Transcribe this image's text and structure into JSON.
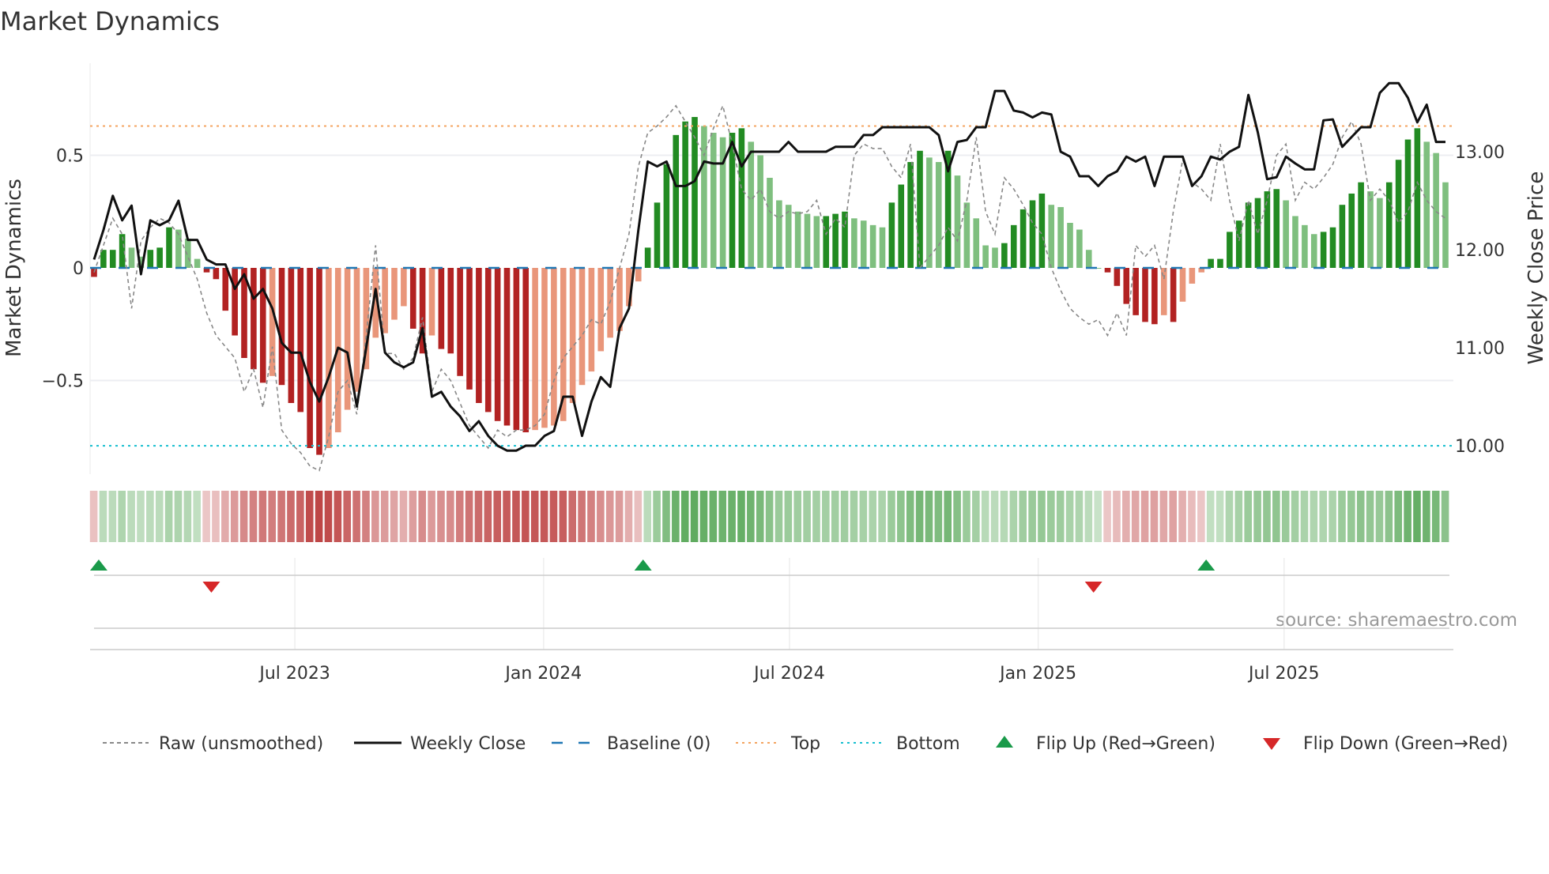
{
  "chart_data": {
    "type": "bar",
    "title": "Market Dynamics",
    "ylabel": "Market Dynamics",
    "y2label": "Weekly Close Price",
    "ylim": [
      -0.9,
      0.93
    ],
    "y2lim": [
      9.75,
      13.85
    ],
    "yticks": [
      {
        "v": 0.5,
        "label": "0.5"
      },
      {
        "v": 0,
        "label": "0"
      },
      {
        "v": -0.5,
        "label": "−0.5"
      }
    ],
    "y2ticks": [
      {
        "v": 13,
        "label": "13.00"
      },
      {
        "v": 12,
        "label": "12.00"
      },
      {
        "v": 11,
        "label": "11.00"
      },
      {
        "v": 10,
        "label": "10.00"
      }
    ],
    "xticks": [
      {
        "week": 21.4,
        "label": "Jul 2023"
      },
      {
        "week": 47.9,
        "label": "Jan 2024"
      },
      {
        "week": 74.1,
        "label": "Jul 2024"
      },
      {
        "week": 100.6,
        "label": "Jan 2025"
      },
      {
        "week": 126.8,
        "label": "Jul 2025"
      }
    ],
    "top_level": 0.63,
    "bottom_level": -0.79,
    "baseline": 0,
    "momentum": [
      -0.04,
      0.08,
      0.08,
      0.15,
      0.09,
      0.05,
      0.08,
      0.09,
      0.18,
      0.17,
      0.13,
      0.04,
      -0.02,
      -0.05,
      -0.19,
      -0.3,
      -0.4,
      -0.45,
      -0.51,
      -0.48,
      -0.52,
      -0.6,
      -0.64,
      -0.8,
      -0.83,
      -0.8,
      -0.73,
      -0.63,
      -0.55,
      -0.45,
      -0.31,
      -0.29,
      -0.23,
      -0.17,
      -0.27,
      -0.38,
      -0.3,
      -0.36,
      -0.38,
      -0.48,
      -0.54,
      -0.6,
      -0.64,
      -0.68,
      -0.7,
      -0.72,
      -0.73,
      -0.72,
      -0.71,
      -0.7,
      -0.68,
      -0.6,
      -0.52,
      -0.46,
      -0.37,
      -0.31,
      -0.28,
      -0.17,
      -0.06,
      0.09,
      0.29,
      0.46,
      0.59,
      0.65,
      0.67,
      0.63,
      0.6,
      0.58,
      0.6,
      0.62,
      0.56,
      0.5,
      0.4,
      0.3,
      0.28,
      0.25,
      0.24,
      0.23,
      0.23,
      0.24,
      0.25,
      0.22,
      0.21,
      0.19,
      0.18,
      0.29,
      0.37,
      0.47,
      0.52,
      0.49,
      0.47,
      0.52,
      0.41,
      0.29,
      0.22,
      0.1,
      0.09,
      0.11,
      0.19,
      0.26,
      0.3,
      0.33,
      0.28,
      0.27,
      0.2,
      0.17,
      0.08,
      0.0,
      -0.02,
      -0.08,
      -0.16,
      -0.21,
      -0.24,
      -0.25,
      -0.21,
      -0.24,
      -0.15,
      -0.07,
      -0.02,
      0.04,
      0.04,
      0.16,
      0.21,
      0.29,
      0.31,
      0.34,
      0.35,
      0.3,
      0.23,
      0.19,
      0.15,
      0.16,
      0.18,
      0.28,
      0.33,
      0.38,
      0.34,
      0.31,
      0.38,
      0.48,
      0.57,
      0.62,
      0.56,
      0.51,
      0.38
    ],
    "raw": [
      -0.02,
      0.1,
      0.22,
      0.15,
      -0.18,
      0.12,
      0.18,
      0.22,
      0.2,
      0.15,
      0.05,
      -0.05,
      -0.2,
      -0.3,
      -0.35,
      -0.4,
      -0.55,
      -0.45,
      -0.62,
      -0.35,
      -0.72,
      -0.78,
      -0.82,
      -0.88,
      -0.9,
      -0.75,
      -0.55,
      -0.5,
      -0.65,
      -0.3,
      0.1,
      -0.38,
      -0.38,
      -0.45,
      -0.4,
      -0.22,
      -0.55,
      -0.45,
      -0.5,
      -0.6,
      -0.7,
      -0.75,
      -0.8,
      -0.72,
      -0.75,
      -0.72,
      -0.72,
      -0.7,
      -0.65,
      -0.5,
      -0.4,
      -0.35,
      -0.3,
      -0.23,
      -0.25,
      -0.15,
      0.0,
      0.15,
      0.45,
      0.6,
      0.63,
      0.67,
      0.72,
      0.65,
      0.58,
      0.5,
      0.62,
      0.72,
      0.55,
      0.35,
      0.3,
      0.35,
      0.25,
      0.22,
      0.25,
      0.24,
      0.25,
      0.3,
      0.15,
      0.22,
      0.18,
      0.5,
      0.55,
      0.53,
      0.53,
      0.45,
      0.4,
      0.55,
      0.0,
      0.05,
      0.1,
      0.18,
      0.12,
      0.3,
      0.58,
      0.25,
      0.15,
      0.4,
      0.35,
      0.28,
      0.2,
      0.15,
      0.0,
      -0.1,
      -0.18,
      -0.22,
      -0.25,
      -0.23,
      -0.3,
      -0.2,
      -0.3,
      0.1,
      0.05,
      0.1,
      -0.05,
      0.25,
      0.48,
      0.38,
      0.35,
      0.3,
      0.55,
      0.3,
      0.12,
      0.3,
      0.15,
      0.3,
      0.5,
      0.55,
      0.3,
      0.38,
      0.35,
      0.4,
      0.46,
      0.58,
      0.65,
      0.55,
      0.3,
      0.35,
      0.3,
      0.2,
      0.25,
      0.38,
      0.3,
      0.25,
      0.22
    ],
    "close": [
      11.9,
      12.2,
      12.55,
      12.3,
      12.45,
      11.75,
      12.3,
      12.25,
      12.3,
      12.5,
      12.1,
      12.1,
      11.9,
      11.85,
      11.85,
      11.6,
      11.75,
      11.5,
      11.6,
      11.4,
      11.05,
      10.95,
      10.95,
      10.65,
      10.45,
      10.7,
      11.0,
      10.95,
      10.4,
      11.0,
      11.6,
      10.95,
      10.85,
      10.8,
      10.85,
      11.2,
      10.5,
      10.55,
      10.4,
      10.3,
      10.15,
      10.25,
      10.1,
      10.0,
      9.95,
      9.95,
      10.0,
      10.0,
      10.1,
      10.15,
      10.5,
      10.5,
      10.1,
      10.45,
      10.7,
      10.6,
      11.2,
      11.4,
      12.2,
      12.9,
      12.85,
      12.9,
      12.65,
      12.65,
      12.7,
      12.9,
      12.88,
      12.88,
      13.1,
      12.85,
      13.0,
      13.0,
      13.0,
      13.0,
      13.1,
      13.0,
      13.0,
      13.0,
      13.0,
      13.05,
      13.05,
      13.05,
      13.17,
      13.17,
      13.25,
      13.25,
      13.25,
      13.25,
      13.25,
      13.25,
      13.17,
      12.8,
      13.1,
      13.12,
      13.25,
      13.25,
      13.62,
      13.62,
      13.42,
      13.4,
      13.35,
      13.4,
      13.38,
      13.0,
      12.95,
      12.75,
      12.75,
      12.65,
      12.75,
      12.8,
      12.95,
      12.9,
      12.95,
      12.65,
      12.95,
      12.95,
      12.95,
      12.65,
      12.75,
      12.95,
      12.92,
      13.0,
      13.05,
      13.58,
      13.2,
      12.72,
      12.74,
      12.95,
      12.88,
      12.82,
      12.82,
      13.32,
      13.33,
      13.05,
      13.15,
      13.25,
      13.25,
      13.6,
      13.7,
      13.7,
      13.55,
      13.3,
      13.48,
      13.1,
      13.1
    ],
    "flips": [
      {
        "week": 0.5,
        "dir": "up"
      },
      {
        "week": 12.5,
        "dir": "down"
      },
      {
        "week": 58.5,
        "dir": "up"
      },
      {
        "week": 106.5,
        "dir": "down"
      },
      {
        "week": 118.5,
        "dir": "up"
      }
    ],
    "colors": {
      "up_strong": "#228b22",
      "up_weak": "#7fbf7f",
      "down_strong": "#b22222",
      "down_weak": "#e9967a",
      "top": "#f4a460",
      "bottom": "#17becf",
      "baseline": "#1f77b4",
      "flip_up": "#1a9a4a",
      "flip_down": "#d62728"
    },
    "legend": [
      {
        "label": "Raw (unsmoothed)",
        "kind": "raw"
      },
      {
        "label": "Weekly Close",
        "kind": "close"
      },
      {
        "label": "Baseline (0)",
        "kind": "baseline"
      },
      {
        "label": "Top",
        "kind": "top"
      },
      {
        "label": "Bottom",
        "kind": "bottom"
      },
      {
        "label": "Flip Up (Red→Green)",
        "kind": "flip_up"
      },
      {
        "label": "Flip Down (Green→Red)",
        "kind": "flip_down"
      }
    ],
    "source": "source: sharemaestro.com"
  }
}
